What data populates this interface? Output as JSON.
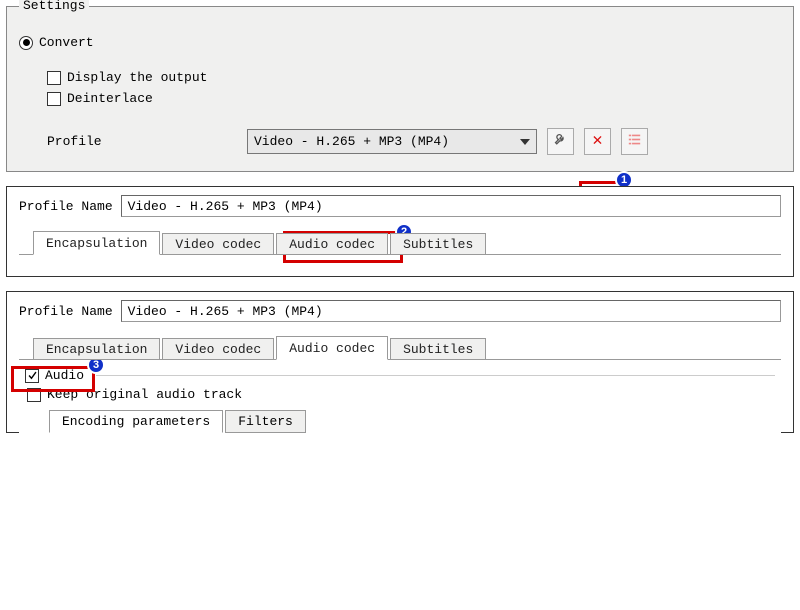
{
  "settings": {
    "fieldset_label": "Settings",
    "convert_label": "Convert",
    "display_output_label": "Display the output",
    "deinterlace_label": "Deinterlace",
    "profile_label": "Profile",
    "profile_value": "Video - H.265 + MP3 (MP4)"
  },
  "dialog1": {
    "profile_name_label": "Profile Name",
    "profile_name_value": "Video - H.265 + MP3 (MP4)",
    "tabs": {
      "encapsulation": "Encapsulation",
      "video_codec": "Video codec",
      "audio_codec": "Audio codec",
      "subtitles": "Subtitles"
    }
  },
  "dialog2": {
    "profile_name_label": "Profile Name",
    "profile_name_value": "Video - H.265 + MP3 (MP4)",
    "tabs": {
      "encapsulation": "Encapsulation",
      "video_codec": "Video codec",
      "audio_codec": "Audio codec",
      "subtitles": "Subtitles"
    },
    "audio_checkbox_label": "Audio",
    "keep_original_label": "Keep original audio track",
    "subtabs": {
      "encoding_params": "Encoding parameters",
      "filters": "Filters"
    }
  },
  "annotations": {
    "b1": "1",
    "b2": "2",
    "b3": "3"
  }
}
